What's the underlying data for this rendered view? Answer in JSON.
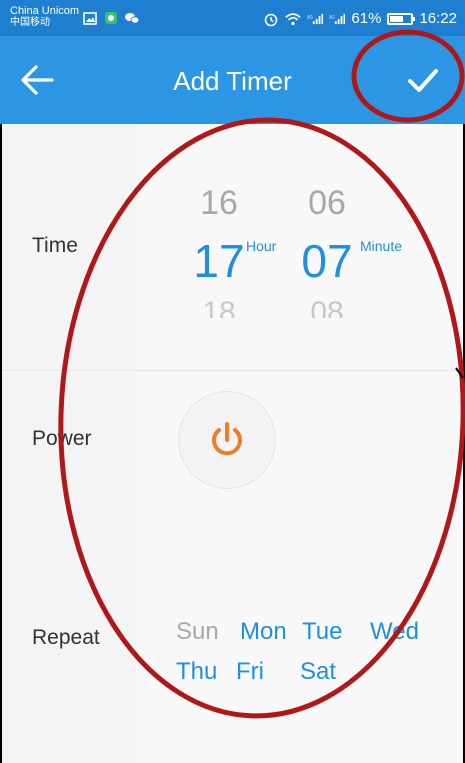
{
  "status_bar": {
    "carrier_line1": "China Unicom",
    "carrier_line2": "中国移动",
    "net1": "3G",
    "net2": "2G",
    "battery": "61%",
    "battery_level": 61,
    "time": "16:22"
  },
  "header": {
    "title": "Add Timer",
    "back_icon": "back-arrow-icon",
    "confirm_icon": "check-icon"
  },
  "time_row": {
    "label": "Time",
    "hour": {
      "prev": "16",
      "current": "17",
      "next": "18",
      "unit": "Hour"
    },
    "minute": {
      "prev": "06",
      "current": "07",
      "next": "08",
      "unit": "Minute"
    }
  },
  "power_row": {
    "label": "Power",
    "icon": "power-icon",
    "icon_color": "#ee7d2b"
  },
  "repeat_row": {
    "label": "Repeat",
    "days": [
      {
        "label": "Sun",
        "selected": false
      },
      {
        "label": "Mon",
        "selected": true
      },
      {
        "label": "Tue",
        "selected": true
      },
      {
        "label": "Wed",
        "selected": true
      },
      {
        "label": "Thu",
        "selected": true
      },
      {
        "label": "Fri",
        "selected": true
      },
      {
        "label": "Sat",
        "selected": true
      }
    ]
  },
  "colors": {
    "accent": "#1e8fe3",
    "header": "#2c95e4",
    "annotation": "#b01818"
  }
}
